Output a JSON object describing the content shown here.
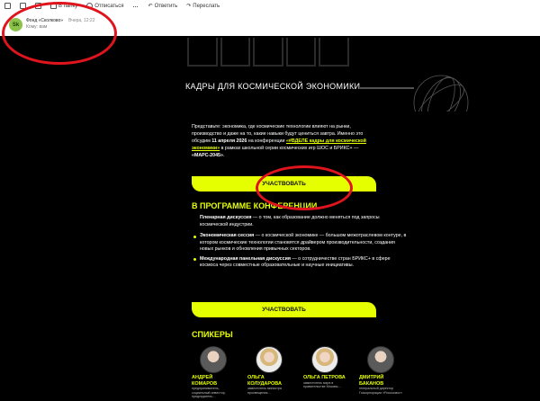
{
  "toolbar": {
    "items": [
      {
        "label": "",
        "icon": "trash-icon"
      },
      {
        "label": "",
        "icon": "archive-icon"
      },
      {
        "label": "",
        "icon": "mail-icon"
      },
      {
        "label": "В папку",
        "icon": "folder-icon"
      },
      {
        "label": "Отписаться",
        "icon": "unsubscribe-icon"
      },
      {
        "label": "…",
        "icon": "more-icon"
      },
      {
        "label": "Ответить",
        "icon": "reply-icon"
      },
      {
        "label": "Переслать",
        "icon": "forward-icon"
      }
    ]
  },
  "sender": {
    "avatar": "Sk",
    "name": "Фонд «Сколково»",
    "time": "Вчера, 12:22",
    "to": "Кому: вам"
  },
  "email": {
    "subtitle": "КАДРЫ ДЛЯ КОСМИЧЕСКОЙ ЭКОНОМИКИ",
    "intro_1": "Представьте: экономика, где космические технологии влияют на рынки, производство и даже на то, какие навыки будут цениться завтра. Именно это обсудим ",
    "intro_date": "11 апреля 2026",
    "intro_2": " на конференции ",
    "intro_link": "«#ВДЕЛЕ кадры для космической экономики»",
    "intro_3": " в рамках школьной серии космических игр ШОС и БРИКС+ — ",
    "intro_mars": "«МАРС-2045»",
    "intro_4": ".",
    "cta_1": "УЧАСТВОВАТЬ",
    "program_title_a": "В ПРОГРАММЕ ",
    "program_title_b": "КОНФЕРЕНЦИИ",
    "plenary_b": "Пленарная дискуссия",
    "plenary_t": " — о том, как образование должно меняться под запросы космической индустрии.",
    "items": [
      {
        "b": "Экономическая сессия",
        "t": " — о космической экономике — большом межотраслевом контуре, в котором космические технологии становятся драйвером производительности, создания новых рынков и обновления привычных секторов."
      },
      {
        "b": "Международная панельная дискуссия",
        "t": " — о сотрудничестве стран БРИКС+ в сфере космоса через совместные образовательные и научные инициативы."
      }
    ],
    "cta_2": "УЧАСТВОВАТЬ",
    "speakers_title": "СПИКЕРЫ",
    "speakers": [
      {
        "name": "АНДРЕЙ КОМАРОВ",
        "role": "предприниматель, социальный инвестор, председатель…"
      },
      {
        "name": "ОЛЬГА КОЛУДАРОВА",
        "role": "заместитель министра просвещения…"
      },
      {
        "name": "ОЛЬГА ПЕТРОВА",
        "role": "заместитель мэра в правительстве Москвы…"
      },
      {
        "name": "ДМИТРИЙ БАКАНОВ",
        "role": "генеральный директор Госкорпорации «Роскосмос»"
      }
    ]
  },
  "colors": {
    "accent": "#e6ff00",
    "annotation": "#e0141c",
    "background": "#000000"
  }
}
